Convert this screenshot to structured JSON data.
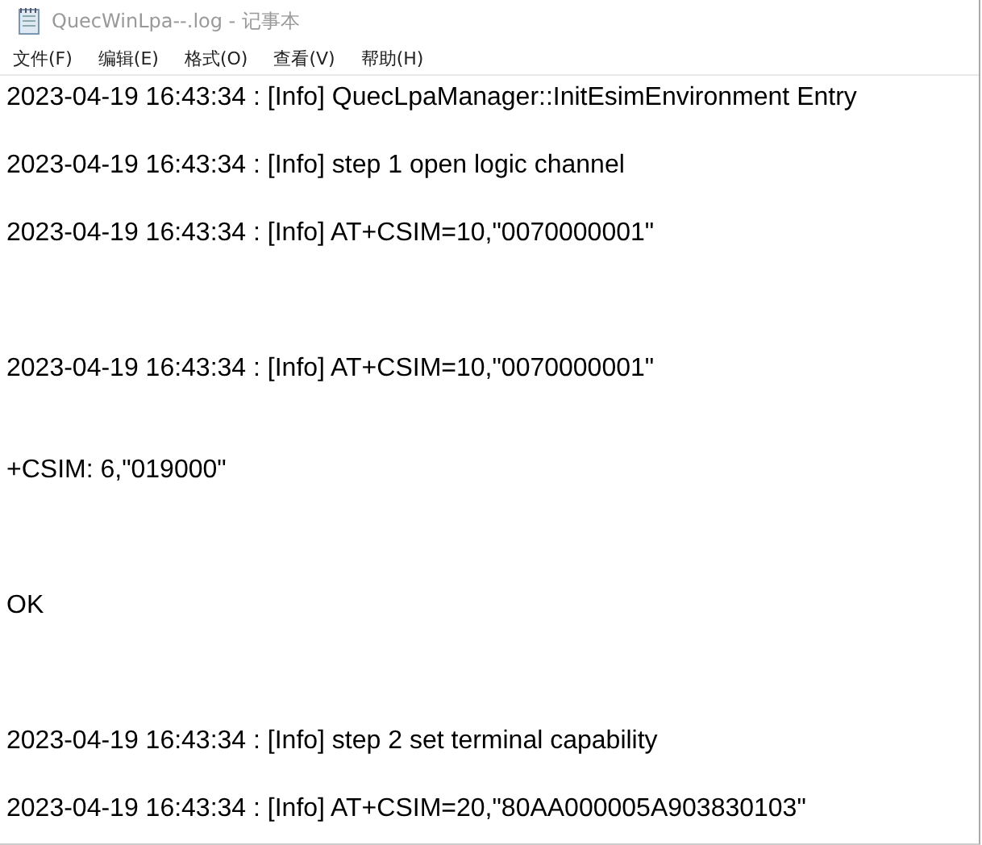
{
  "window": {
    "title": "QuecWinLpa--.log - 记事本"
  },
  "menu": [
    "文件(F)",
    "编辑(E)",
    "格式(O)",
    "查看(V)",
    "帮助(H)"
  ],
  "lines": [
    {
      "kind": "text",
      "text": "2023-04-19 16:43:34 : [Info] QuecLpaManager::InitEsimEnvironment Entry"
    },
    {
      "kind": "blank"
    },
    {
      "kind": "text",
      "text": "2023-04-19 16:43:34 : [Info] step 1 open logic channel"
    },
    {
      "kind": "blank"
    },
    {
      "kind": "text",
      "text": "2023-04-19 16:43:34 : [Info] AT+CSIM=10,\"0070000001\""
    },
    {
      "kind": "blank"
    },
    {
      "kind": "blank"
    },
    {
      "kind": "blank"
    },
    {
      "kind": "text",
      "text": "2023-04-19 16:43:34 : [Info] AT+CSIM=10,\"0070000001\""
    },
    {
      "kind": "blank"
    },
    {
      "kind": "blank"
    },
    {
      "kind": "text",
      "text": "+CSIM: 6,\"019000\""
    },
    {
      "kind": "blank"
    },
    {
      "kind": "blank"
    },
    {
      "kind": "blank"
    },
    {
      "kind": "text",
      "text": "OK"
    },
    {
      "kind": "blank"
    },
    {
      "kind": "blank"
    },
    {
      "kind": "blank"
    },
    {
      "kind": "text",
      "text": "2023-04-19 16:43:34 : [Info] step 2 set terminal capability"
    },
    {
      "kind": "blank"
    },
    {
      "kind": "text",
      "text": "2023-04-19 16:43:34 : [Info] AT+CSIM=20,\"80AA000005A903830103\""
    }
  ]
}
